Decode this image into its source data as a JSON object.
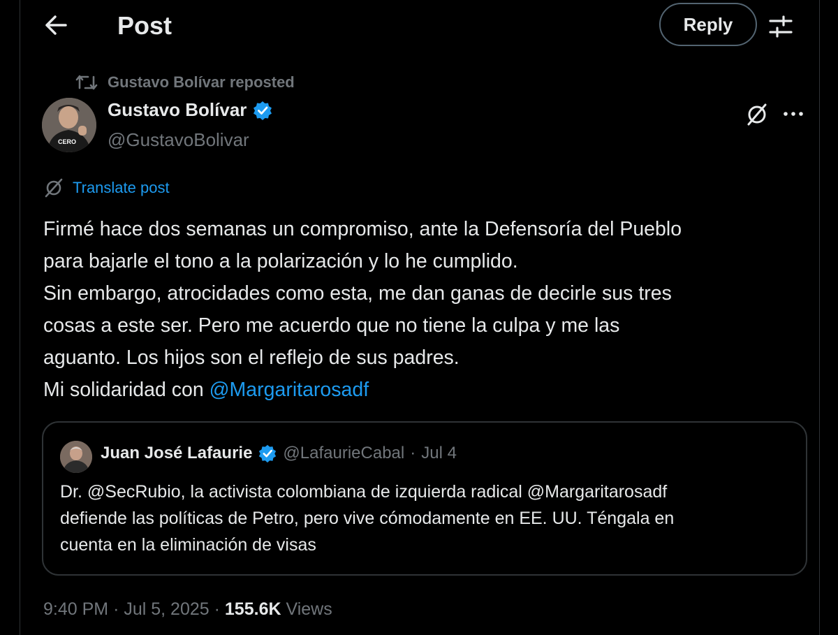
{
  "header": {
    "title": "Post",
    "reply_label": "Reply"
  },
  "repost": {
    "text": "Gustavo Bolívar reposted"
  },
  "author": {
    "name": "Gustavo Bolívar",
    "handle": "@GustavoBolivar",
    "avatar_shirt_text": "CERO"
  },
  "translate": {
    "label": "Translate post"
  },
  "post": {
    "lines": [
      "Firmé hace dos semanas un compromiso, ante la Defensoría del Pueblo",
      "para bajarle el tono a la polarización y lo he cumplido.",
      "Sin embargo, atrocidades como esta, me dan ganas de decirle sus tres",
      "cosas a este ser. Pero me acuerdo que no tiene la culpa y me las",
      "aguanto. Los hijos son el reflejo de sus padres."
    ],
    "last_line_prefix": "Mi solidaridad con ",
    "last_line_mention": "@Margaritarosadf"
  },
  "quote": {
    "name": "Juan José Lafaurie",
    "handle": "@LafaurieCabal",
    "date": "Jul 4",
    "lines": [
      "Dr. @SecRubio, la activista colombiana de izquierda radical @Margaritarosadf",
      "defiende las políticas de Petro, pero vive cómodamente en EE. UU. Téngala en",
      "cuenta en la eliminación de visas"
    ]
  },
  "meta": {
    "time": "9:40 PM",
    "date": "Jul 5, 2025",
    "views_count": "155.6K",
    "views_label": "Views"
  },
  "colors": {
    "background": "#000000",
    "text": "#e7e9ea",
    "muted": "#71767b",
    "accent": "#1d9bf0",
    "border": "#2f3336"
  },
  "icons": [
    "back-arrow-icon",
    "settings-sliders-icon",
    "repost-icon",
    "verified-badge-icon",
    "grok-icon",
    "more-icon",
    "translate-icon"
  ]
}
